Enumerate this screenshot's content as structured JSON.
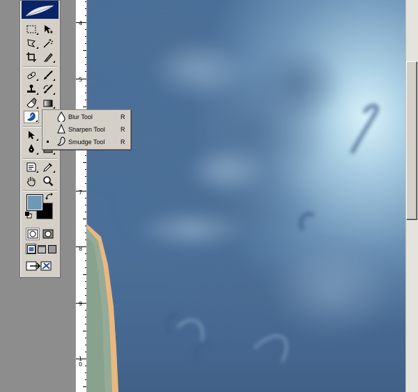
{
  "flyout": {
    "items": [
      {
        "label": "Blur Tool",
        "shortcut": "R",
        "icon": "blur-drop-icon",
        "selected": false
      },
      {
        "label": "Sharpen Tool",
        "shortcut": "R",
        "icon": "sharpen-cone-icon",
        "selected": false
      },
      {
        "label": "Smudge Tool",
        "shortcut": "R",
        "icon": "smudge-finger-icon",
        "selected": true
      }
    ]
  },
  "ruler": {
    "labels": [
      "4",
      "5",
      "6",
      "7",
      "8",
      "9",
      "10"
    ]
  },
  "toolbox": {
    "tools": [
      "marquee-icon",
      "move-icon",
      "lasso-icon",
      "magic-wand-icon",
      "crop-icon",
      "slice-icon",
      "healing-brush-icon",
      "brush-icon",
      "clone-stamp-icon",
      "history-brush-icon",
      "eraser-icon",
      "gradient-icon",
      "smudge-icon",
      "dodge-icon",
      "path-selection-icon",
      "type-icon",
      "pen-icon",
      "shape-icon",
      "notes-icon",
      "eyedropper-icon",
      "hand-icon",
      "zoom-icon"
    ],
    "foreground_color": "#6e98b8",
    "background_color": "#000000"
  },
  "colors": {
    "toolbox_bg": "#d4d0c8",
    "title_bar": "#0a246a",
    "canvas_base": "#5a7fa6"
  }
}
